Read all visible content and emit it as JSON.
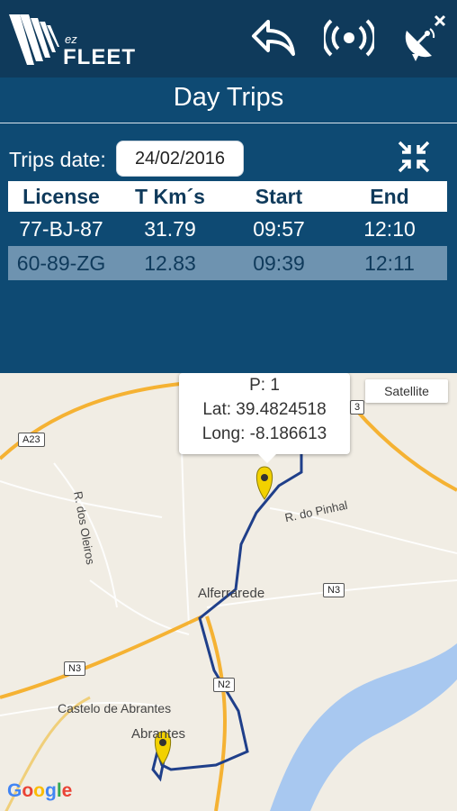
{
  "app": {
    "logo_prefix": "ez",
    "logo_name": "FLEET"
  },
  "toolbar": {
    "back_icon": "back-arrow-icon",
    "signal_icon": "broadcast-icon",
    "satellite_icon": "satellite-dish-icon"
  },
  "page": {
    "title": "Day Trips"
  },
  "filters": {
    "date_label": "Trips date:",
    "date_value": "24/02/2016"
  },
  "trips_table": {
    "headers": [
      "License",
      "T Km´s",
      "Start",
      "End"
    ],
    "rows": [
      {
        "license": "77-BJ-87",
        "km": "31.79",
        "start": "09:57",
        "end": "12:10"
      },
      {
        "license": "60-89-ZG",
        "km": "12.83",
        "start": "09:39",
        "end": "12:11"
      }
    ],
    "selected_index": 1
  },
  "map": {
    "satellite_button": "Satellite",
    "info": {
      "point": "P: 1",
      "lat": "Lat: 39.4824518",
      "long": "Long: -8.186613"
    },
    "labels": {
      "a23": "A23",
      "dos_oleiros": "R. dos Oleiros",
      "do_pinhal": "R. do Pinhal",
      "alferrarede": "Alferrarede",
      "n3_right": "N3",
      "n3_left": "N3",
      "n2": "N2",
      "castelo": "Castelo de Abrantes",
      "abrantes": "Abrantes",
      "a23_right": "3"
    },
    "attribution": "Google",
    "colors": {
      "route": "#1f3f8a",
      "marker": "#f2d100",
      "river": "#a8c8f0",
      "major_road": "#f5b233"
    }
  }
}
